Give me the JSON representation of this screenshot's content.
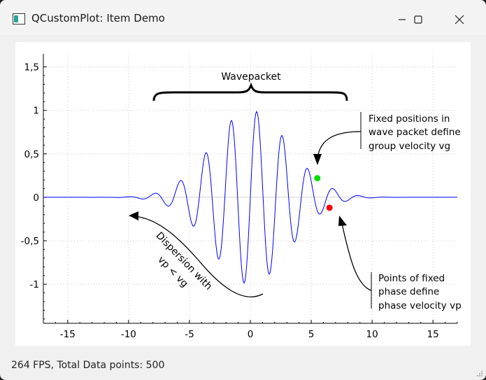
{
  "window": {
    "title": "QCustomPlot: Item Demo",
    "controls": {
      "minimize_icon": "minimize-icon",
      "maximize_icon": "maximize-icon",
      "close_icon": "close-icon"
    }
  },
  "chart_data": {
    "type": "line",
    "xlim": [
      -17,
      17
    ],
    "ylim": [
      -1.45,
      1.65
    ],
    "x_ticks": [
      -15,
      -10,
      -5,
      0,
      5,
      10,
      15
    ],
    "x_tick_labels": [
      "-15",
      "-10",
      "-5",
      "0",
      "5",
      "10",
      "15"
    ],
    "y_ticks": [
      -1,
      -0.5,
      0,
      0.5,
      1,
      1.5
    ],
    "y_tick_labels": [
      "-1",
      "-0,5",
      "0",
      "0,5",
      "1",
      "1,5"
    ],
    "grid": true,
    "series": [
      {
        "color": "#0000ff",
        "function": "sin(3x) * exp(-((x)^2)/20)",
        "x_range": [
          -17,
          17
        ],
        "samples": 500
      }
    ],
    "annotations": {
      "wavepacket_label": "Wavepacket",
      "dispersion_line1": "Dispersion with",
      "dispersion_line2": "vp < vg",
      "group_text": [
        "Fixed positions in",
        "wave packet define",
        "group velocity vg"
      ],
      "phase_text": [
        "Points of fixed",
        "phase define",
        "phase velocity vp"
      ]
    },
    "markers": [
      {
        "name": "green-point",
        "x": 5.5,
        "y": 0.22,
        "color": "#00e000"
      },
      {
        "name": "red-point",
        "x": 6.5,
        "y": -0.12,
        "color": "#ff0000"
      }
    ]
  },
  "status": {
    "text": "264 FPS, Total Data points: 500"
  }
}
